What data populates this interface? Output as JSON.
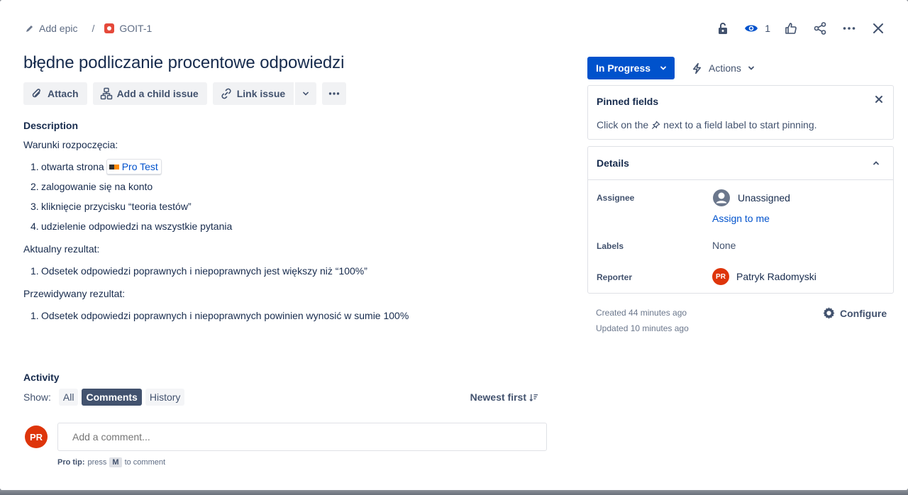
{
  "breadcrumb": {
    "epic_label": "Add epic",
    "separator": "/",
    "issue_key": "GOIT-1"
  },
  "top_actions": {
    "watch_count": "1"
  },
  "issue": {
    "title": "błędne podliczanie procentowe odpowiedzi"
  },
  "toolbar": {
    "attach": "Attach",
    "child_issue": "Add a child issue",
    "link_issue": "Link issue"
  },
  "description": {
    "label": "Description",
    "conditions_heading": "Warunki rozpoczęcia:",
    "conditions": [
      {
        "num": "1.",
        "text": "otwarta strona",
        "link": "Pro Test"
      },
      {
        "num": "2.",
        "text": "zalogowanie się na konto"
      },
      {
        "num": "3.",
        "text": "kliknięcie przycisku “teoria testów”"
      },
      {
        "num": "4.",
        "text": "udzielenie odpowiedzi na wszystkie pytania"
      }
    ],
    "actual_heading": "Aktualny rezultat:",
    "actual": [
      {
        "num": "1.",
        "text": "Odsetek odpowiedzi poprawnych i niepoprawnych jest większy niż “100%”"
      }
    ],
    "expected_heading": "Przewidywany rezultat:",
    "expected": [
      {
        "num": "1.",
        "text": "Odsetek odpowiedzi poprawnych i niepoprawnych powinien wynosić w sumie 100%"
      }
    ]
  },
  "activity": {
    "label": "Activity",
    "show_label": "Show:",
    "filters": [
      "All",
      "Comments",
      "History"
    ],
    "active_filter": "Comments",
    "sort_label": "Newest first",
    "comment_placeholder": "Add a comment...",
    "avatar_initials": "PR",
    "pro_tip_label": "Pro tip:",
    "pro_tip_press": "press",
    "pro_tip_key": "M",
    "pro_tip_suffix": "to comment"
  },
  "status": {
    "label": "In Progress",
    "color": "#0052cc"
  },
  "actions_label": "Actions",
  "pinned": {
    "title": "Pinned fields",
    "text_before": "Click on the",
    "text_after": "next to a field label to start pinning."
  },
  "details": {
    "title": "Details",
    "assignee_label": "Assignee",
    "assignee_value": "Unassigned",
    "assign_to_me": "Assign to me",
    "labels_label": "Labels",
    "labels_value": "None",
    "reporter_label": "Reporter",
    "reporter_initials": "PR",
    "reporter_name": "Patryk Radomyski"
  },
  "meta": {
    "created": "Created 44 minutes ago",
    "updated": "Updated 10 minutes ago",
    "configure": "Configure"
  }
}
